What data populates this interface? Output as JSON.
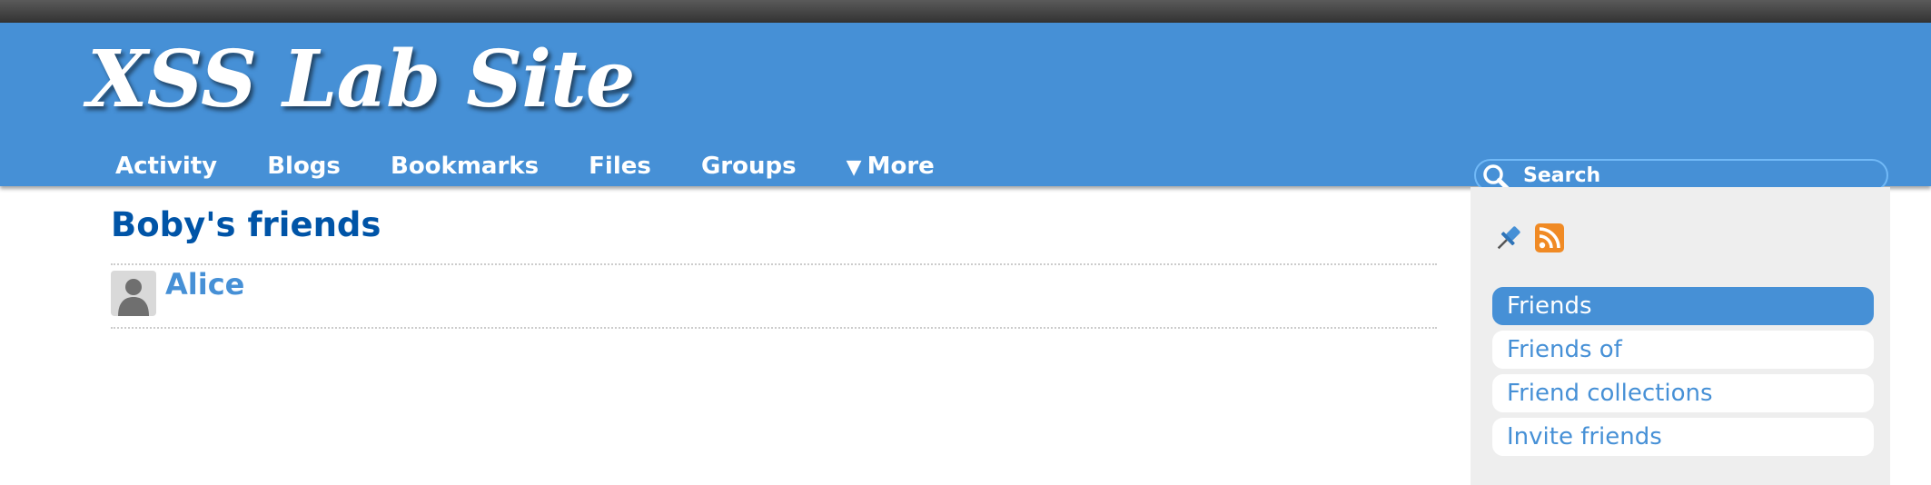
{
  "site": {
    "title": "XSS Lab Site"
  },
  "nav": {
    "items": [
      "Activity",
      "Blogs",
      "Bookmarks",
      "Files",
      "Groups"
    ],
    "more_arrow": "▼",
    "more_label": "More"
  },
  "search": {
    "placeholder": "Search"
  },
  "main": {
    "page_title": "Boby's friends",
    "friends": [
      {
        "name": "Alice"
      }
    ]
  },
  "sidebar": {
    "owner_icons": [
      "pin-icon",
      "rss-icon"
    ],
    "menu": [
      {
        "label": "Friends",
        "selected": true
      },
      {
        "label": "Friends of",
        "selected": false
      },
      {
        "label": "Friend collections",
        "selected": false
      },
      {
        "label": "Invite friends",
        "selected": false
      }
    ]
  },
  "colors": {
    "header_blue": "#4690d6",
    "title_blue": "#0054a7",
    "sidebar_bg": "#eeeeee",
    "rss_orange": "#f08a24"
  }
}
